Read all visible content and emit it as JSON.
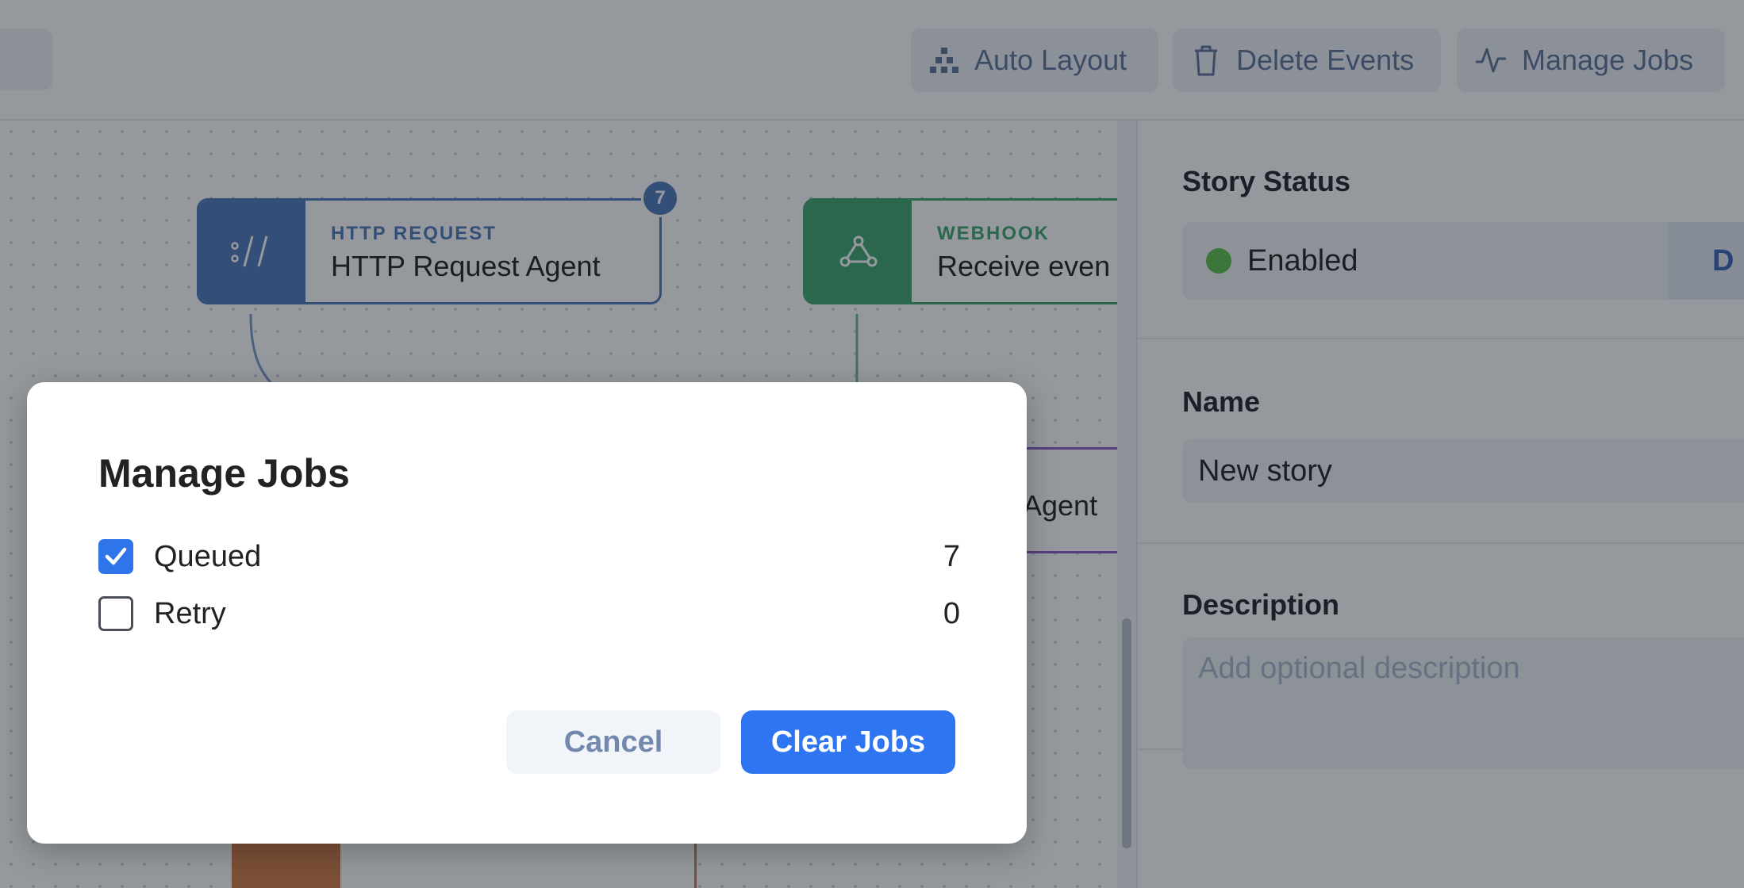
{
  "toolbar": {
    "auto_layout": "Auto Layout",
    "delete_events": "Delete Events",
    "manage_jobs": "Manage Jobs"
  },
  "nodes": [
    {
      "type": "HTTP REQUEST",
      "name": "HTTP Request Agent",
      "badge": "7",
      "color": "#4f78b8"
    },
    {
      "type": "WEBHOOK",
      "name": "Receive even",
      "color": "#3fa56b"
    },
    {
      "name_fragment": "Agent",
      "color": "#8e5cc4"
    }
  ],
  "panel": {
    "story_status_label": "Story Status",
    "status_value": "Enabled",
    "status_segment": "D",
    "name_label": "Name",
    "name_value": "New story",
    "description_label": "Description",
    "description_placeholder": "Add optional description"
  },
  "modal": {
    "title": "Manage Jobs",
    "jobs": [
      {
        "label": "Queued",
        "count": "7",
        "checked": true
      },
      {
        "label": "Retry",
        "count": "0",
        "checked": false
      }
    ],
    "cancel_label": "Cancel",
    "clear_label": "Clear Jobs"
  }
}
